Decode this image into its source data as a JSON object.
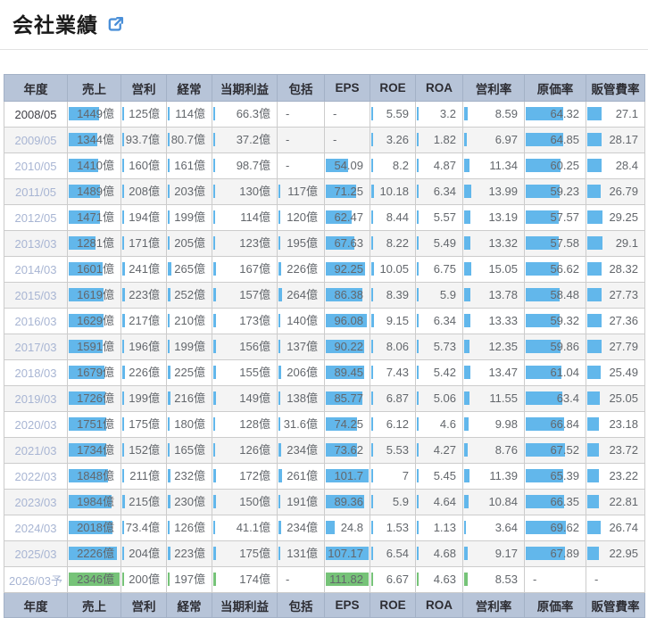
{
  "header": {
    "title": "会社業績",
    "link_icon": "external-link-icon"
  },
  "colors": {
    "bar_blue": "#62b7eb",
    "bar_green": "#76c378",
    "header_bg": "#b7c4d8"
  },
  "table": {
    "columns": [
      {
        "key": "year",
        "label": "年度",
        "type": "year"
      },
      {
        "key": "sales",
        "label": "売上",
        "type": "money"
      },
      {
        "key": "op",
        "label": "営利",
        "type": "money"
      },
      {
        "key": "ord",
        "label": "経常",
        "type": "money"
      },
      {
        "key": "net",
        "label": "当期利益",
        "type": "money"
      },
      {
        "key": "comp",
        "label": "包括",
        "type": "money"
      },
      {
        "key": "eps",
        "label": "EPS",
        "type": "percent"
      },
      {
        "key": "roe",
        "label": "ROE",
        "type": "percent"
      },
      {
        "key": "roa",
        "label": "ROA",
        "type": "percent"
      },
      {
        "key": "opm",
        "label": "営利率",
        "type": "percent"
      },
      {
        "key": "cost",
        "label": "原価率",
        "type": "percent"
      },
      {
        "key": "sga",
        "label": "販管費率",
        "type": "percent"
      }
    ],
    "rows": [
      {
        "year": "2008/05",
        "forecast": false,
        "values": [
          {
            "t": "1449億",
            "v": 1449
          },
          {
            "t": "125億",
            "v": 125
          },
          {
            "t": "114億",
            "v": 114
          },
          {
            "t": "66.3億",
            "v": 66.3
          },
          {
            "t": "-",
            "v": null
          },
          {
            "t": "-",
            "v": null
          },
          {
            "t": "5.59",
            "v": 5.59
          },
          {
            "t": "3.2",
            "v": 3.2
          },
          {
            "t": "8.59",
            "v": 8.59
          },
          {
            "t": "64.32",
            "v": 64.32
          },
          {
            "t": "27.1",
            "v": 27.1
          }
        ]
      },
      {
        "year": "2009/05",
        "forecast": false,
        "values": [
          {
            "t": "1344億",
            "v": 1344
          },
          {
            "t": "93.7億",
            "v": 93.7
          },
          {
            "t": "80.7億",
            "v": 80.7
          },
          {
            "t": "37.2億",
            "v": 37.2
          },
          {
            "t": "-",
            "v": null
          },
          {
            "t": "-",
            "v": null
          },
          {
            "t": "3.26",
            "v": 3.26
          },
          {
            "t": "1.82",
            "v": 1.82
          },
          {
            "t": "6.97",
            "v": 6.97
          },
          {
            "t": "64.85",
            "v": 64.85
          },
          {
            "t": "28.17",
            "v": 28.17
          }
        ]
      },
      {
        "year": "2010/05",
        "forecast": false,
        "values": [
          {
            "t": "1410億",
            "v": 1410
          },
          {
            "t": "160億",
            "v": 160
          },
          {
            "t": "161億",
            "v": 161
          },
          {
            "t": "98.7億",
            "v": 98.7
          },
          {
            "t": "-",
            "v": null
          },
          {
            "t": "54.09",
            "v": 54.09
          },
          {
            "t": "8.2",
            "v": 8.2
          },
          {
            "t": "4.87",
            "v": 4.87
          },
          {
            "t": "11.34",
            "v": 11.34
          },
          {
            "t": "60.25",
            "v": 60.25
          },
          {
            "t": "28.4",
            "v": 28.4
          }
        ]
      },
      {
        "year": "2011/05",
        "forecast": false,
        "values": [
          {
            "t": "1489億",
            "v": 1489
          },
          {
            "t": "208億",
            "v": 208
          },
          {
            "t": "203億",
            "v": 203
          },
          {
            "t": "130億",
            "v": 130
          },
          {
            "t": "117億",
            "v": 117
          },
          {
            "t": "71.25",
            "v": 71.25
          },
          {
            "t": "10.18",
            "v": 10.18
          },
          {
            "t": "6.34",
            "v": 6.34
          },
          {
            "t": "13.99",
            "v": 13.99
          },
          {
            "t": "59.23",
            "v": 59.23
          },
          {
            "t": "26.79",
            "v": 26.79
          }
        ]
      },
      {
        "year": "2012/05",
        "forecast": false,
        "values": [
          {
            "t": "1471億",
            "v": 1471
          },
          {
            "t": "194億",
            "v": 194
          },
          {
            "t": "199億",
            "v": 199
          },
          {
            "t": "114億",
            "v": 114
          },
          {
            "t": "120億",
            "v": 120
          },
          {
            "t": "62.47",
            "v": 62.47
          },
          {
            "t": "8.44",
            "v": 8.44
          },
          {
            "t": "5.57",
            "v": 5.57
          },
          {
            "t": "13.19",
            "v": 13.19
          },
          {
            "t": "57.57",
            "v": 57.57
          },
          {
            "t": "29.25",
            "v": 29.25
          }
        ]
      },
      {
        "year": "2013/03",
        "forecast": false,
        "values": [
          {
            "t": "1281億",
            "v": 1281
          },
          {
            "t": "171億",
            "v": 171
          },
          {
            "t": "205億",
            "v": 205
          },
          {
            "t": "123億",
            "v": 123
          },
          {
            "t": "195億",
            "v": 195
          },
          {
            "t": "67.63",
            "v": 67.63
          },
          {
            "t": "8.22",
            "v": 8.22
          },
          {
            "t": "5.49",
            "v": 5.49
          },
          {
            "t": "13.32",
            "v": 13.32
          },
          {
            "t": "57.58",
            "v": 57.58
          },
          {
            "t": "29.1",
            "v": 29.1
          }
        ]
      },
      {
        "year": "2014/03",
        "forecast": false,
        "values": [
          {
            "t": "1601億",
            "v": 1601
          },
          {
            "t": "241億",
            "v": 241
          },
          {
            "t": "265億",
            "v": 265
          },
          {
            "t": "167億",
            "v": 167
          },
          {
            "t": "226億",
            "v": 226
          },
          {
            "t": "92.25",
            "v": 92.25
          },
          {
            "t": "10.05",
            "v": 10.05
          },
          {
            "t": "6.75",
            "v": 6.75
          },
          {
            "t": "15.05",
            "v": 15.05
          },
          {
            "t": "56.62",
            "v": 56.62
          },
          {
            "t": "28.32",
            "v": 28.32
          }
        ]
      },
      {
        "year": "2015/03",
        "forecast": false,
        "values": [
          {
            "t": "1619億",
            "v": 1619
          },
          {
            "t": "223億",
            "v": 223
          },
          {
            "t": "252億",
            "v": 252
          },
          {
            "t": "157億",
            "v": 157
          },
          {
            "t": "264億",
            "v": 264
          },
          {
            "t": "86.38",
            "v": 86.38
          },
          {
            "t": "8.39",
            "v": 8.39
          },
          {
            "t": "5.9",
            "v": 5.9
          },
          {
            "t": "13.78",
            "v": 13.78
          },
          {
            "t": "58.48",
            "v": 58.48
          },
          {
            "t": "27.73",
            "v": 27.73
          }
        ]
      },
      {
        "year": "2016/03",
        "forecast": false,
        "values": [
          {
            "t": "1629億",
            "v": 1629
          },
          {
            "t": "217億",
            "v": 217
          },
          {
            "t": "210億",
            "v": 210
          },
          {
            "t": "173億",
            "v": 173
          },
          {
            "t": "140億",
            "v": 140
          },
          {
            "t": "96.08",
            "v": 96.08
          },
          {
            "t": "9.15",
            "v": 9.15
          },
          {
            "t": "6.34",
            "v": 6.34
          },
          {
            "t": "13.33",
            "v": 13.33
          },
          {
            "t": "59.32",
            "v": 59.32
          },
          {
            "t": "27.36",
            "v": 27.36
          }
        ]
      },
      {
        "year": "2017/03",
        "forecast": false,
        "values": [
          {
            "t": "1591億",
            "v": 1591
          },
          {
            "t": "196億",
            "v": 196
          },
          {
            "t": "199億",
            "v": 199
          },
          {
            "t": "156億",
            "v": 156
          },
          {
            "t": "137億",
            "v": 137
          },
          {
            "t": "90.22",
            "v": 90.22
          },
          {
            "t": "8.06",
            "v": 8.06
          },
          {
            "t": "5.73",
            "v": 5.73
          },
          {
            "t": "12.35",
            "v": 12.35
          },
          {
            "t": "59.86",
            "v": 59.86
          },
          {
            "t": "27.79",
            "v": 27.79
          }
        ]
      },
      {
        "year": "2018/03",
        "forecast": false,
        "values": [
          {
            "t": "1679億",
            "v": 1679
          },
          {
            "t": "226億",
            "v": 226
          },
          {
            "t": "225億",
            "v": 225
          },
          {
            "t": "155億",
            "v": 155
          },
          {
            "t": "206億",
            "v": 206
          },
          {
            "t": "89.45",
            "v": 89.45
          },
          {
            "t": "7.43",
            "v": 7.43
          },
          {
            "t": "5.42",
            "v": 5.42
          },
          {
            "t": "13.47",
            "v": 13.47
          },
          {
            "t": "61.04",
            "v": 61.04
          },
          {
            "t": "25.49",
            "v": 25.49
          }
        ]
      },
      {
        "year": "2019/03",
        "forecast": false,
        "values": [
          {
            "t": "1726億",
            "v": 1726
          },
          {
            "t": "199億",
            "v": 199
          },
          {
            "t": "216億",
            "v": 216
          },
          {
            "t": "149億",
            "v": 149
          },
          {
            "t": "138億",
            "v": 138
          },
          {
            "t": "85.77",
            "v": 85.77
          },
          {
            "t": "6.87",
            "v": 6.87
          },
          {
            "t": "5.06",
            "v": 5.06
          },
          {
            "t": "11.55",
            "v": 11.55
          },
          {
            "t": "63.4",
            "v": 63.4
          },
          {
            "t": "25.05",
            "v": 25.05
          }
        ]
      },
      {
        "year": "2020/03",
        "forecast": false,
        "values": [
          {
            "t": "1751億",
            "v": 1751
          },
          {
            "t": "175億",
            "v": 175
          },
          {
            "t": "180億",
            "v": 180
          },
          {
            "t": "128億",
            "v": 128
          },
          {
            "t": "31.6億",
            "v": 31.6
          },
          {
            "t": "74.25",
            "v": 74.25
          },
          {
            "t": "6.12",
            "v": 6.12
          },
          {
            "t": "4.6",
            "v": 4.6
          },
          {
            "t": "9.98",
            "v": 9.98
          },
          {
            "t": "66.84",
            "v": 66.84
          },
          {
            "t": "23.18",
            "v": 23.18
          }
        ]
      },
      {
        "year": "2021/03",
        "forecast": false,
        "values": [
          {
            "t": "1734億",
            "v": 1734
          },
          {
            "t": "152億",
            "v": 152
          },
          {
            "t": "165億",
            "v": 165
          },
          {
            "t": "126億",
            "v": 126
          },
          {
            "t": "234億",
            "v": 234
          },
          {
            "t": "73.62",
            "v": 73.62
          },
          {
            "t": "5.53",
            "v": 5.53
          },
          {
            "t": "4.27",
            "v": 4.27
          },
          {
            "t": "8.76",
            "v": 8.76
          },
          {
            "t": "67.52",
            "v": 67.52
          },
          {
            "t": "23.72",
            "v": 23.72
          }
        ]
      },
      {
        "year": "2022/03",
        "forecast": false,
        "values": [
          {
            "t": "1848億",
            "v": 1848
          },
          {
            "t": "211億",
            "v": 211
          },
          {
            "t": "232億",
            "v": 232
          },
          {
            "t": "172億",
            "v": 172
          },
          {
            "t": "261億",
            "v": 261
          },
          {
            "t": "101.7",
            "v": 101.7
          },
          {
            "t": "7",
            "v": 7
          },
          {
            "t": "5.45",
            "v": 5.45
          },
          {
            "t": "11.39",
            "v": 11.39
          },
          {
            "t": "65.39",
            "v": 65.39
          },
          {
            "t": "23.22",
            "v": 23.22
          }
        ]
      },
      {
        "year": "2023/03",
        "forecast": false,
        "values": [
          {
            "t": "1984億",
            "v": 1984
          },
          {
            "t": "215億",
            "v": 215
          },
          {
            "t": "230億",
            "v": 230
          },
          {
            "t": "150億",
            "v": 150
          },
          {
            "t": "191億",
            "v": 191
          },
          {
            "t": "89.36",
            "v": 89.36
          },
          {
            "t": "5.9",
            "v": 5.9
          },
          {
            "t": "4.64",
            "v": 4.64
          },
          {
            "t": "10.84",
            "v": 10.84
          },
          {
            "t": "66.35",
            "v": 66.35
          },
          {
            "t": "22.81",
            "v": 22.81
          }
        ]
      },
      {
        "year": "2024/03",
        "forecast": false,
        "values": [
          {
            "t": "2018億",
            "v": 2018
          },
          {
            "t": "73.4億",
            "v": 73.4
          },
          {
            "t": "126億",
            "v": 126
          },
          {
            "t": "41.1億",
            "v": 41.1
          },
          {
            "t": "234億",
            "v": 234
          },
          {
            "t": "24.8",
            "v": 24.8
          },
          {
            "t": "1.53",
            "v": 1.53
          },
          {
            "t": "1.13",
            "v": 1.13
          },
          {
            "t": "3.64",
            "v": 3.64
          },
          {
            "t": "69.62",
            "v": 69.62
          },
          {
            "t": "26.74",
            "v": 26.74
          }
        ]
      },
      {
        "year": "2025/03",
        "forecast": false,
        "values": [
          {
            "t": "2226億",
            "v": 2226
          },
          {
            "t": "204億",
            "v": 204
          },
          {
            "t": "223億",
            "v": 223
          },
          {
            "t": "175億",
            "v": 175
          },
          {
            "t": "131億",
            "v": 131
          },
          {
            "t": "107.17",
            "v": 107.17
          },
          {
            "t": "6.54",
            "v": 6.54
          },
          {
            "t": "4.68",
            "v": 4.68
          },
          {
            "t": "9.17",
            "v": 9.17
          },
          {
            "t": "67.89",
            "v": 67.89
          },
          {
            "t": "22.95",
            "v": 22.95
          }
        ]
      },
      {
        "year": "2026/03予",
        "forecast": true,
        "values": [
          {
            "t": "2346億",
            "v": 2346
          },
          {
            "t": "200億",
            "v": 200
          },
          {
            "t": "197億",
            "v": 197
          },
          {
            "t": "174億",
            "v": 174
          },
          {
            "t": "-",
            "v": null
          },
          {
            "t": "111.82",
            "v": 111.82
          },
          {
            "t": "6.67",
            "v": 6.67
          },
          {
            "t": "4.63",
            "v": 4.63
          },
          {
            "t": "8.53",
            "v": 8.53
          },
          {
            "t": "-",
            "v": null
          },
          {
            "t": "-",
            "v": null
          }
        ]
      }
    ]
  }
}
